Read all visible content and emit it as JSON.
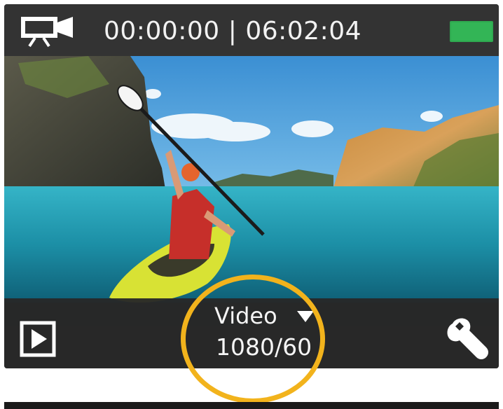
{
  "topbar": {
    "mode_icon": "video-camera-icon",
    "elapsed_time": "00:00:00",
    "separator": "|",
    "remaining_time": "06:02:04",
    "timecode_display": "00:00:00 | 06:02:04",
    "battery_icon": "battery-icon",
    "battery_color": "#2fa84f"
  },
  "preview": {
    "image": "kayaker-on-turquoise-sea-photo"
  },
  "bottombar": {
    "playback_icon": "play-icon",
    "mode_label": "Video",
    "mode_caret_icon": "caret-down-icon",
    "resolution": "1080/60",
    "settings_icon": "wrench-icon"
  },
  "annotation": {
    "highlight_color": "#f2b31c"
  }
}
